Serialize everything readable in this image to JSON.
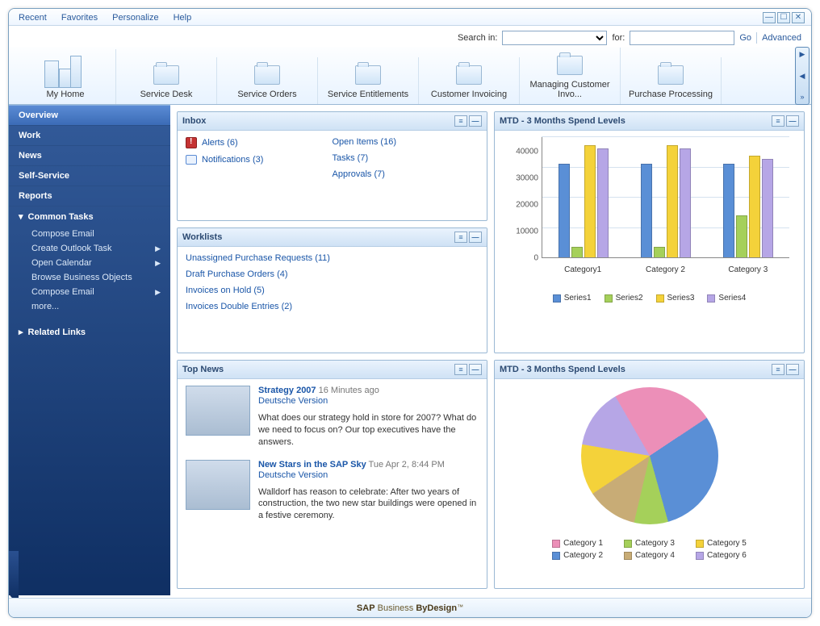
{
  "menubar": {
    "recent": "Recent",
    "favorites": "Favorites",
    "personalize": "Personalize",
    "help": "Help"
  },
  "search": {
    "label": "Search in:",
    "for": "for:",
    "go": "Go",
    "advanced": "Advanced"
  },
  "tabs": {
    "home": "My Home",
    "items": [
      "Service Desk",
      "Service Orders",
      "Service Entitlements",
      "Customer Invoicing",
      "Managing Customer Invo...",
      "Purchase Processing"
    ]
  },
  "sidebar": {
    "nav": [
      "Overview",
      "Work",
      "News",
      "Self-Service",
      "Reports"
    ],
    "common_tasks_header": "Common Tasks",
    "common_tasks": [
      "Compose Email",
      "Create Outlook Task",
      "Open Calendar",
      "Browse Business Objects",
      "Compose Email",
      "more..."
    ],
    "common_tasks_caret": [
      false,
      true,
      true,
      false,
      true,
      false
    ],
    "related_links": "Related Links"
  },
  "panels": {
    "inbox": {
      "title": "Inbox",
      "alerts": "Alerts (6)",
      "notifications": "Notifications (3)",
      "open_items": "Open Items (16)",
      "tasks": "Tasks (7)",
      "approvals": "Approvals (7)"
    },
    "worklists": {
      "title": "Worklists",
      "items": [
        "Unassigned Purchase Requests (11)",
        "Draft Purchase Orders (4)",
        "Invoices on Hold (5)",
        "Invoices Double Entries (2)"
      ]
    },
    "news": {
      "title": "Top News",
      "item1": {
        "title": "Strategy 2007",
        "time": "16 Minutes ago",
        "sub": "Deutsche Version",
        "body": "What does our strategy hold in store for 2007? What do we need to focus on? Our top executives have the answers."
      },
      "item2": {
        "title": "New Stars in the SAP Sky",
        "time": "Tue Apr 2, 8:44 PM",
        "sub": "Deutsche Version",
        "body": "Walldorf has reason to celebrate: After two years of construction, the two new star buildings were opened in a festive ceremony."
      }
    },
    "bar": {
      "title": "MTD - 3 Months Spend Levels"
    },
    "pie": {
      "title": "MTD - 3 Months Spend Levels"
    }
  },
  "footer": {
    "brand_a": "SAP",
    "brand_b": "Business",
    "brand_c": "ByDesign"
  },
  "chart_data": [
    {
      "type": "bar",
      "title": "MTD - 3 Months Spend Levels",
      "categories": [
        "Category1",
        "Category 2",
        "Category 3"
      ],
      "series": [
        {
          "name": "Series1",
          "values": [
            31000,
            31000,
            31000
          ],
          "color": "#5a8fd6"
        },
        {
          "name": "Series2",
          "values": [
            3500,
            3500,
            14000
          ],
          "color": "#a5d05a"
        },
        {
          "name": "Series3",
          "values": [
            37000,
            37000,
            33500
          ],
          "color": "#f4d23a"
        },
        {
          "name": "Series4",
          "values": [
            36000,
            36000,
            32500
          ],
          "color": "#b6a6e6"
        }
      ],
      "ylim": [
        0,
        40000
      ],
      "yticks": [
        0,
        10000,
        20000,
        30000,
        40000
      ]
    },
    {
      "type": "pie",
      "title": "MTD - 3 Months Spend Levels",
      "slices": [
        {
          "name": "Category 1",
          "value": 24,
          "color": "#ec8fb8"
        },
        {
          "name": "Category 2",
          "value": 30,
          "color": "#5a8fd6"
        },
        {
          "name": "Category 3",
          "value": 8,
          "color": "#a5d05a"
        },
        {
          "name": "Category 4",
          "value": 12,
          "color": "#c8ac76"
        },
        {
          "name": "Category 5",
          "value": 12,
          "color": "#f4d23a"
        },
        {
          "name": "Category 6",
          "value": 14,
          "color": "#b6a6e6"
        }
      ]
    }
  ]
}
